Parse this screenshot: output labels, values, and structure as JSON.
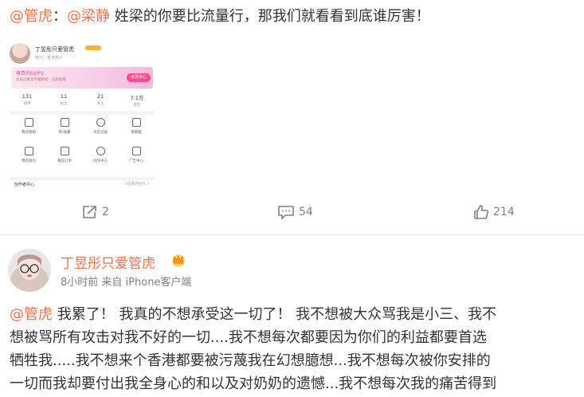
{
  "post1": {
    "author_mention": "@管虎",
    "colon": "：",
    "reply_mention": "@梁静",
    "text": "姓梁的你要比流量行，那我们就看看到底谁厉害！",
    "image": {
      "profile_name": "丁昱彤只爱管虎",
      "profile_sub": "简介：暂无简介",
      "banner_title": "尊贵的SVIP2",
      "banner_sub": "会员已尊享专属特权 · 立即查看",
      "banner_button": "会员中心",
      "stats": [
        {
          "num": "131",
          "label": "微博"
        },
        {
          "num": "11",
          "label": "粉丝"
        },
        {
          "num": "21",
          "label": "关注"
        },
        {
          "num": "7.1万",
          "label": "获赞"
        }
      ],
      "menu": [
        "我的相册",
        "赞/收藏",
        "浏览记录",
        "草稿箱",
        "我的钱包",
        "我的订单",
        "创作中心",
        "广告中心"
      ],
      "footer_left": "创作者中心",
      "footer_right": "V全部开创作 >"
    },
    "actions": {
      "repost_count": "2",
      "comment_count": "54",
      "like_count": "214"
    }
  },
  "post2": {
    "author": "丁昱彤只爱管虎",
    "time": "8小时前",
    "source": "来自 iPhone客户端",
    "mention": "@管虎",
    "lines": [
      " 我累了！ 我真的不想承受这一切了！ 我不想被大众骂我是小三、我不",
      "想被骂所有攻击对我不好的一切....我不想每次都要因为你们的利益都要首选",
      "牺牲我.....我不想来个香港都要被污蔑我在幻想臆想...我不想每次被你安排的",
      "一切而我却要付出我全身心的和以及对奶奶的遗憾...我不想每次我的痛苦得到"
    ]
  },
  "colors": {
    "link": "#eb7350",
    "text": "#333333",
    "muted": "#808080"
  }
}
